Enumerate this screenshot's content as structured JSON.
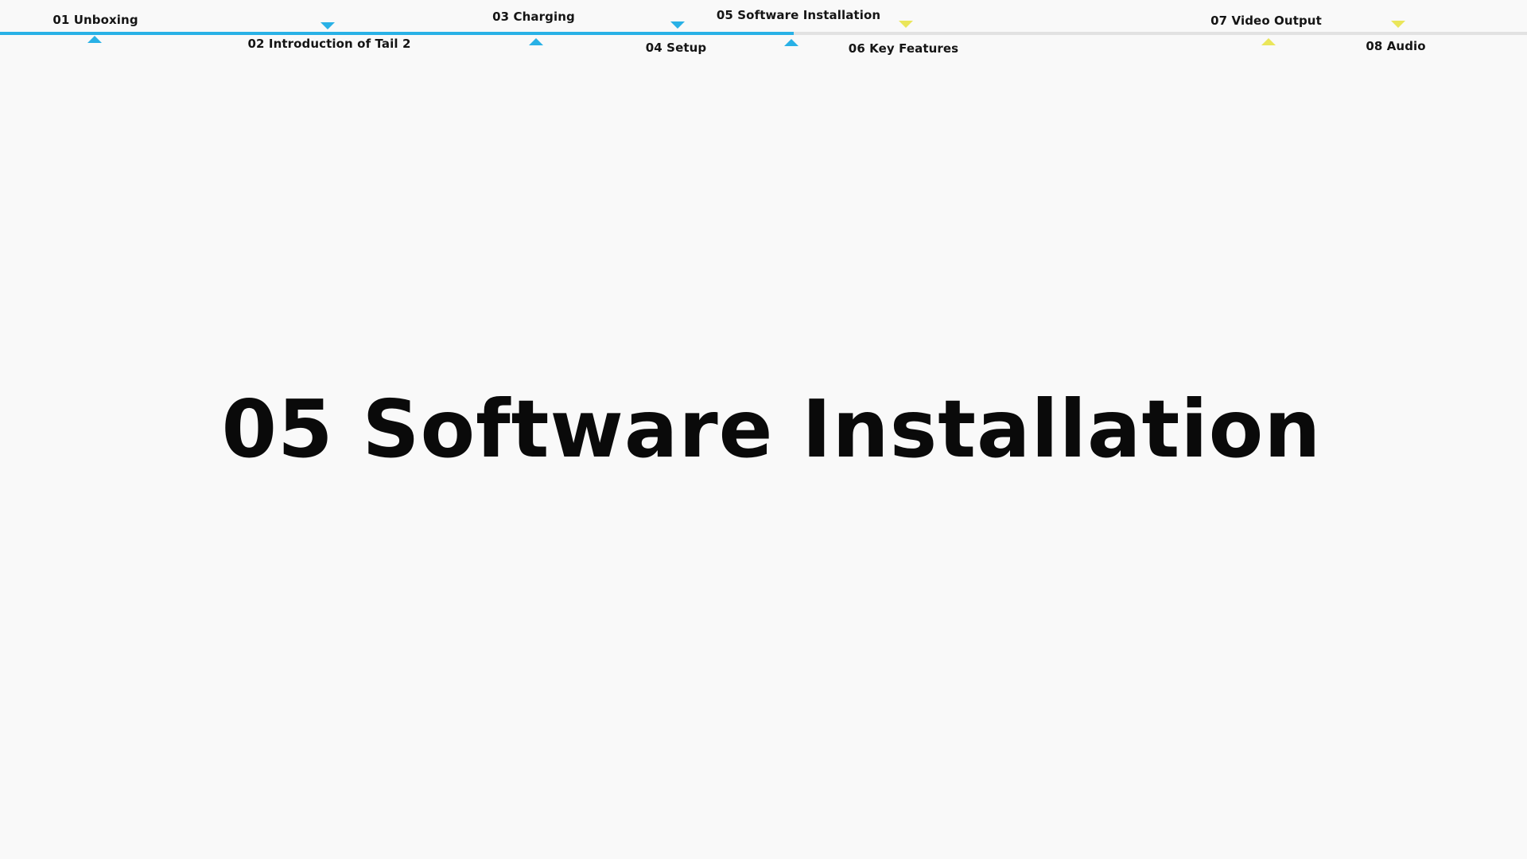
{
  "timeline": {
    "progress_fraction": 0.52,
    "active_color": "#29b1e6",
    "pending_color": "#eae65a",
    "chapters": [
      {
        "label": "01 Unboxing",
        "state": "done",
        "marker": "up-arrow-icon"
      },
      {
        "label": "02 Introduction of Tail 2",
        "state": "done",
        "marker": "down-arrow-icon"
      },
      {
        "label": "03 Charging",
        "state": "done",
        "marker": "up-arrow-icon"
      },
      {
        "label": "04 Setup",
        "state": "done",
        "marker": "down-arrow-icon"
      },
      {
        "label": "05 Software Installation",
        "state": "current",
        "marker": "up-arrow-icon"
      },
      {
        "label": "06 Key Features",
        "state": "pending",
        "marker": "down-arrow-icon"
      },
      {
        "label": "07 Video Output",
        "state": "pending",
        "marker": "up-arrow-icon"
      },
      {
        "label": "08 Audio",
        "state": "pending",
        "marker": "down-arrow-icon"
      }
    ]
  },
  "main": {
    "title": "05 Software Installation"
  }
}
